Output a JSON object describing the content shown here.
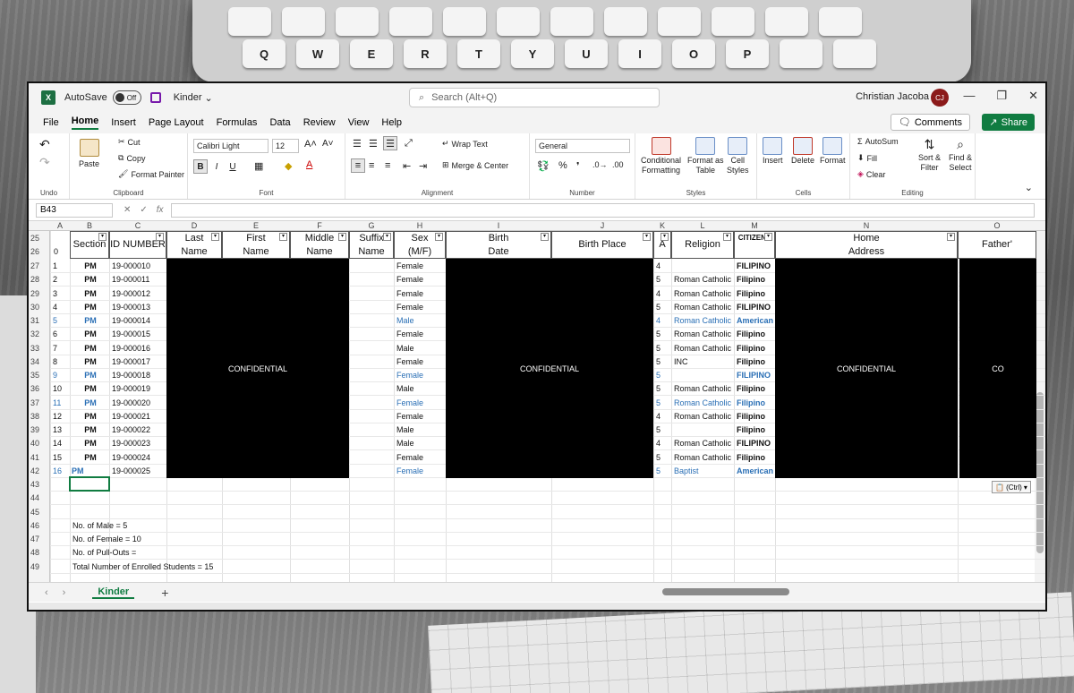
{
  "titlebar": {
    "autosave_label": "AutoSave",
    "autosave_state": "Off",
    "doc_name": "Kinder",
    "search_placeholder": "Search (Alt+Q)",
    "user_name": "Christian Jacoba",
    "user_initials": "CJ"
  },
  "menu": {
    "tabs": [
      "File",
      "Home",
      "Insert",
      "Page Layout",
      "Formulas",
      "Data",
      "Review",
      "View",
      "Help"
    ],
    "active": "Home",
    "comments_label": "Comments",
    "share_label": "Share"
  },
  "ribbon": {
    "undo_label": "Undo",
    "clipboard": {
      "label": "Clipboard",
      "paste": "Paste",
      "cut": "Cut",
      "copy": "Copy",
      "format_painter": "Format Painter"
    },
    "font": {
      "label": "Font",
      "name": "Calibri Light",
      "size": "12",
      "bold": "B",
      "italic": "I",
      "underline": "U"
    },
    "alignment": {
      "label": "Alignment",
      "wrap_text": "Wrap Text",
      "merge_center": "Merge & Center"
    },
    "number": {
      "label": "Number",
      "format": "General"
    },
    "styles": {
      "label": "Styles",
      "conditional": "Conditional",
      "formatting": "Formatting",
      "format_as": "Format as",
      "table": "Table",
      "cell": "Cell",
      "cell_styles": "Styles"
    },
    "cells": {
      "label": "Cells",
      "insert": "Insert",
      "delete": "Delete",
      "format": "Format"
    },
    "editing": {
      "label": "Editing",
      "autosum": "AutoSum",
      "fill": "Fill",
      "clear": "Clear",
      "sort": "Sort &",
      "filter": "Filter",
      "find": "Find &",
      "select": "Select"
    }
  },
  "formula_bar": {
    "name_box": "B43",
    "fx": "fx",
    "content": ""
  },
  "columns": [
    "A",
    "B",
    "C",
    "D",
    "E",
    "F",
    "G",
    "H",
    "I",
    "J",
    "K",
    "L",
    "M",
    "N",
    "O"
  ],
  "headers": {
    "section": "Section",
    "id_number": "ID NUMBER",
    "last_name_1": "Last",
    "last_name_2": "Name",
    "first_name_1": "First",
    "first_name_2": "Name",
    "middle_name_1": "Middle",
    "middle_name_2": "Name",
    "suffix_1": "Suffix",
    "suffix_2": "Name",
    "sex_1": "Sex",
    "sex_2": "(M/F)",
    "birth_date_1": "Birth",
    "birth_date_2": "Date",
    "birth_place": "Birth Place",
    "age": "A",
    "religion": "Religion",
    "citizenship": "CITIZENS",
    "home_address_1": "Home",
    "home_address_2": "Address",
    "father": "Father'"
  },
  "row_numbers": [
    "25",
    "26",
    "27",
    "28",
    "29",
    "30",
    "31",
    "32",
    "33",
    "34",
    "35",
    "36",
    "37",
    "38",
    "39",
    "40",
    "41",
    "42",
    "43",
    "44",
    "45",
    "46",
    "47",
    "48",
    "49"
  ],
  "rows": [
    {
      "n": "1",
      "sec": "PM",
      "id": "19-000010",
      "sex": "Female",
      "age": "4",
      "rel": "",
      "cit": "FILIPINO",
      "blue": false
    },
    {
      "n": "2",
      "sec": "PM",
      "id": "19-000011",
      "sex": "Female",
      "age": "5",
      "rel": "Roman Catholic",
      "cit": "Filipino",
      "blue": false
    },
    {
      "n": "3",
      "sec": "PM",
      "id": "19-000012",
      "sex": "Female",
      "age": "4",
      "rel": "Roman Catholic",
      "cit": "Filipino",
      "blue": false
    },
    {
      "n": "4",
      "sec": "PM",
      "id": "19-000013",
      "sex": "Female",
      "age": "5",
      "rel": "Roman Catholic",
      "cit": "FILIPINO",
      "blue": false
    },
    {
      "n": "5",
      "sec": "PM",
      "id": "19-000014",
      "sex": "Male",
      "age": "4",
      "rel": "Roman Catholic",
      "cit": "American",
      "blue": true
    },
    {
      "n": "6",
      "sec": "PM",
      "id": "19-000015",
      "sex": "Female",
      "age": "5",
      "rel": "Roman Catholic",
      "cit": "Filipino",
      "blue": false
    },
    {
      "n": "7",
      "sec": "PM",
      "id": "19-000016",
      "sex": "Male",
      "age": "5",
      "rel": "Roman Catholic",
      "cit": "Filipino",
      "blue": false
    },
    {
      "n": "8",
      "sec": "PM",
      "id": "19-000017",
      "sex": "Female",
      "age": "5",
      "rel": "INC",
      "cit": "Filipino",
      "blue": false
    },
    {
      "n": "9",
      "sec": "PM",
      "id": "19-000018",
      "sex": "Female",
      "age": "5",
      "rel": "",
      "cit": "FILIPINO",
      "blue": true
    },
    {
      "n": "10",
      "sec": "PM",
      "id": "19-000019",
      "sex": "Male",
      "age": "5",
      "rel": "Roman Catholic",
      "cit": "Filipino",
      "blue": false
    },
    {
      "n": "11",
      "sec": "PM",
      "id": "19-000020",
      "sex": "Female",
      "age": "5",
      "rel": "Roman Catholic",
      "cit": "Filipino",
      "blue": true
    },
    {
      "n": "12",
      "sec": "PM",
      "id": "19-000021",
      "sex": "Female",
      "age": "4",
      "rel": "Roman Catholic",
      "cit": "Filipino",
      "blue": false
    },
    {
      "n": "13",
      "sec": "PM",
      "id": "19-000022",
      "sex": "Male",
      "age": "5",
      "rel": "",
      "cit": "Filipino",
      "blue": false
    },
    {
      "n": "14",
      "sec": "PM",
      "id": "19-000023",
      "sex": "Male",
      "age": "4",
      "rel": "Roman Catholic",
      "cit": "FILIPINO",
      "blue": false
    },
    {
      "n": "15",
      "sec": "PM",
      "id": "19-000024",
      "sex": "Female",
      "age": "5",
      "rel": "Roman Catholic",
      "cit": "Filipino",
      "blue": false
    },
    {
      "n": "16",
      "sec": "PM",
      "id": "19-000025",
      "sex": "Female",
      "age": "5",
      "rel": "Baptist",
      "cit": "American",
      "blue": true
    }
  ],
  "confidential_label": "CONFIDENTIAL",
  "confidential_partial": "CO",
  "summary": {
    "male": "No. of Male = 5",
    "female": "No. of Female = 10",
    "pullouts": "No. of Pull-Outs =",
    "total": "Total Number of Enrolled Students = 15"
  },
  "paste_options": "(Ctrl)",
  "sheet_tab": "Kinder",
  "add_sheet": "+"
}
